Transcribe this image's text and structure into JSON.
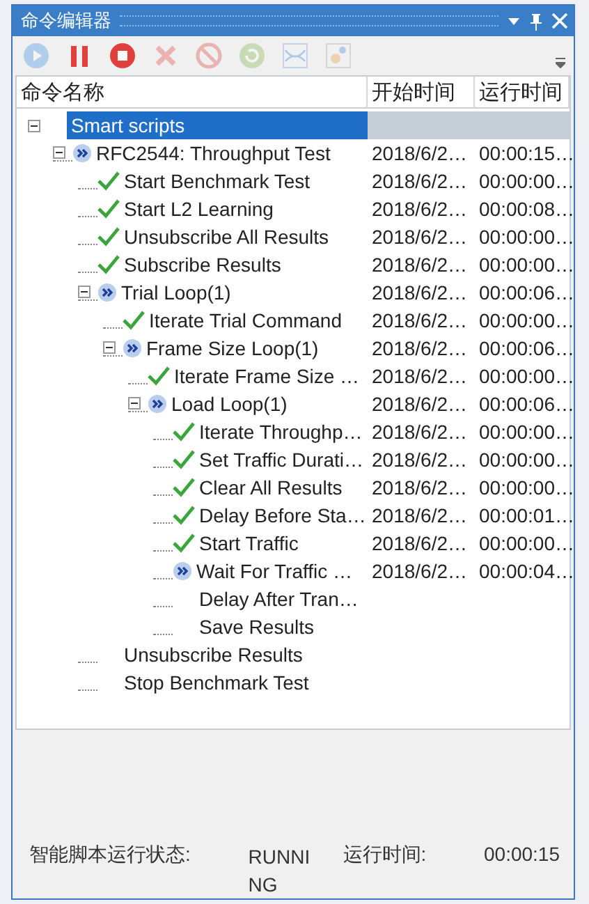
{
  "window": {
    "title": "命令编辑器"
  },
  "toolbar": [
    {
      "kind": "play",
      "disabled": true
    },
    {
      "kind": "pause",
      "disabled": false
    },
    {
      "kind": "stop",
      "disabled": false
    },
    {
      "kind": "delete",
      "disabled": true
    },
    {
      "kind": "cancel",
      "disabled": true
    },
    {
      "kind": "refresh",
      "disabled": true
    },
    {
      "kind": "chart",
      "disabled": true
    },
    {
      "kind": "tools",
      "disabled": true
    }
  ],
  "table": {
    "columns": [
      "命令名称",
      "开始时间",
      "运行时间"
    ],
    "tree": [
      {
        "name": "Smart scripts",
        "kind": "none",
        "selected": true,
        "expanded": true,
        "children": [
          {
            "name": "RFC2544: Throughput Test",
            "kind": "running",
            "start": "2018/6/2…",
            "elapsed": "00:00:15…",
            "selected": false,
            "expanded": true,
            "children": [
              {
                "name": "Start Benchmark Test",
                "kind": "done",
                "start": "2018/6/2…",
                "elapsed": "00:00:00…",
                "selected": false
              },
              {
                "name": "Start L2 Learning",
                "kind": "done",
                "start": "2018/6/2…",
                "elapsed": "00:00:08…",
                "selected": false
              },
              {
                "name": "Unsubscribe All Results",
                "kind": "done",
                "start": "2018/6/2…",
                "elapsed": "00:00:00…",
                "selected": false
              },
              {
                "name": "Subscribe Results",
                "kind": "done",
                "start": "2018/6/2…",
                "elapsed": "00:00:00…",
                "selected": false
              },
              {
                "name": "Trial Loop(1)",
                "kind": "running",
                "start": "2018/6/2…",
                "elapsed": "00:00:06…",
                "selected": false,
                "expanded": true,
                "children": [
                  {
                    "name": "Iterate Trial Command",
                    "kind": "done",
                    "start": "2018/6/2…",
                    "elapsed": "00:00:00…",
                    "selected": false
                  },
                  {
                    "name": "Frame Size Loop(1)",
                    "kind": "running",
                    "start": "2018/6/2…",
                    "elapsed": "00:00:06…",
                    "selected": false,
                    "expanded": true,
                    "children": [
                      {
                        "name": "Iterate Frame Size …",
                        "kind": "done",
                        "start": "2018/6/2…",
                        "elapsed": "00:00:00…",
                        "selected": false
                      },
                      {
                        "name": "Load Loop(1)",
                        "kind": "running",
                        "start": "2018/6/2…",
                        "elapsed": "00:00:06…",
                        "selected": false,
                        "expanded": true,
                        "children": [
                          {
                            "name": "Iterate Throughp…",
                            "kind": "done",
                            "start": "2018/6/2…",
                            "elapsed": "00:00:00…",
                            "selected": false
                          },
                          {
                            "name": "Set Traffic Durati…",
                            "kind": "done",
                            "start": "2018/6/2…",
                            "elapsed": "00:00:00…",
                            "selected": false
                          },
                          {
                            "name": "Clear All Results",
                            "kind": "done",
                            "start": "2018/6/2…",
                            "elapsed": "00:00:00…",
                            "selected": false
                          },
                          {
                            "name": "Delay Before Sta…",
                            "kind": "done",
                            "start": "2018/6/2…",
                            "elapsed": "00:00:01…",
                            "selected": false
                          },
                          {
                            "name": "Start Traffic",
                            "kind": "done",
                            "start": "2018/6/2…",
                            "elapsed": "00:00:00…",
                            "selected": false
                          },
                          {
                            "name": "Wait For Traffic …",
                            "kind": "running",
                            "start": "2018/6/2…",
                            "elapsed": "00:00:04…",
                            "selected": false
                          },
                          {
                            "name": "Delay After Tran…",
                            "kind": "none",
                            "selected": false
                          },
                          {
                            "name": "Save Results",
                            "kind": "none",
                            "selected": false
                          }
                        ]
                      }
                    ]
                  }
                ]
              },
              {
                "name": "Unsubscribe Results",
                "kind": "none",
                "selected": false
              },
              {
                "name": "Stop Benchmark Test",
                "kind": "none",
                "selected": false
              }
            ]
          }
        ]
      }
    ]
  },
  "status_bar": {
    "state_label": "智能脚本运行状态:",
    "state": "RUNNING",
    "time_label": "运行时间:",
    "time": "00:00:15"
  }
}
